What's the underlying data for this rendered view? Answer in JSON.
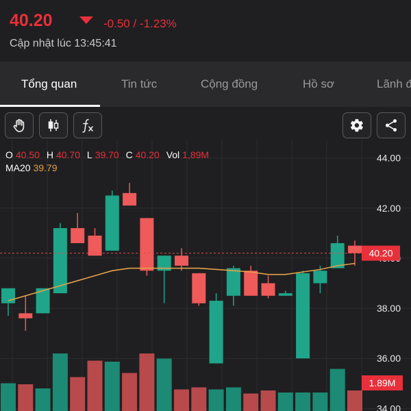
{
  "quote": {
    "price": "40.20",
    "change": "-0.50 / -1.23%",
    "updated": "Cập nhật lúc 13:45:41",
    "direction_icon": "triangle-down-icon"
  },
  "tabs": [
    {
      "label": "Tổng quan",
      "active": true
    },
    {
      "label": "Tin tức",
      "active": false
    },
    {
      "label": "Cộng đồng",
      "active": false
    },
    {
      "label": "Hồ sơ",
      "active": false
    },
    {
      "label": "Lãnh đ",
      "active": false
    }
  ],
  "toolbar": {
    "left": [
      "hand-icon",
      "candlestick-icon",
      "function-icon"
    ],
    "right": [
      "gear-icon",
      "share-icon"
    ]
  },
  "legend": {
    "o_label": "O",
    "o": "40.50",
    "h_label": "H",
    "h": "40.70",
    "l_label": "L",
    "l": "39.70",
    "c_label": "C",
    "c": "40.20",
    "vol_label": "Vol",
    "vol": "1,89M",
    "ma_label": "MA20",
    "ma": "39.79"
  },
  "colors": {
    "up": "#1fa58a",
    "down": "#ef5a5a",
    "price_tag": "#e8303a",
    "ma": "#e4a14a",
    "background": "#1f1f21"
  },
  "chart_data": {
    "type": "candlestick",
    "y_ticks": [
      "44.00",
      "42.00",
      "40.00",
      "38.00",
      "36.00",
      "34.00"
    ],
    "y_range": [
      33.9,
      44.7
    ],
    "last_price_label": "40.20",
    "last_volume_label": "1.89M",
    "grid": true,
    "candles": [
      {
        "o": 38.2,
        "h": 38.6,
        "l": 37.7,
        "c": 38.8,
        "vol": 1.35,
        "up": true
      },
      {
        "o": 37.8,
        "h": 38.5,
        "l": 37.1,
        "c": 37.6,
        "vol": 1.3,
        "up": false
      },
      {
        "o": 37.8,
        "h": 38.7,
        "l": 37.8,
        "c": 38.8,
        "vol": 1.1,
        "up": true
      },
      {
        "o": 38.6,
        "h": 41.4,
        "l": 38.6,
        "c": 41.2,
        "vol": 2.8,
        "up": true
      },
      {
        "o": 41.2,
        "h": 41.8,
        "l": 40.9,
        "c": 40.6,
        "vol": 1.65,
        "up": false
      },
      {
        "o": 40.9,
        "h": 41.2,
        "l": 40.6,
        "c": 40.1,
        "vol": 2.45,
        "up": false
      },
      {
        "o": 40.3,
        "h": 42.7,
        "l": 40.3,
        "c": 42.5,
        "vol": 2.4,
        "up": true
      },
      {
        "o": 42.6,
        "h": 43.0,
        "l": 42.1,
        "c": 42.1,
        "vol": 1.85,
        "up": false
      },
      {
        "o": 41.6,
        "h": 41.6,
        "l": 39.3,
        "c": 39.5,
        "vol": 2.8,
        "up": false
      },
      {
        "o": 39.5,
        "h": 40.1,
        "l": 38.2,
        "c": 40.1,
        "vol": 2.55,
        "up": true
      },
      {
        "o": 40.1,
        "h": 40.4,
        "l": 39.5,
        "c": 39.7,
        "vol": 1.05,
        "up": false
      },
      {
        "o": 39.4,
        "h": 39.4,
        "l": 38.1,
        "c": 38.2,
        "vol": 1.15,
        "up": false
      },
      {
        "o": 38.3,
        "h": 38.6,
        "l": 35.9,
        "c": 35.8,
        "vol": 1.05,
        "up": true
      },
      {
        "o": 39.6,
        "h": 39.7,
        "l": 38.1,
        "c": 38.5,
        "vol": 1.15,
        "up": true
      },
      {
        "o": 39.5,
        "h": 39.7,
        "l": 38.6,
        "c": 38.5,
        "vol": 0.85,
        "up": false
      },
      {
        "o": 39.0,
        "h": 39.3,
        "l": 38.4,
        "c": 38.5,
        "vol": 1.0,
        "up": false
      },
      {
        "o": 38.6,
        "h": 38.7,
        "l": 38.5,
        "c": 38.5,
        "vol": 0.9,
        "up": true
      },
      {
        "o": 39.4,
        "h": 39.5,
        "l": 36.0,
        "c": 36.0,
        "vol": 0.9,
        "up": true
      },
      {
        "o": 39.0,
        "h": 39.7,
        "l": 38.6,
        "c": 39.5,
        "vol": 0.9,
        "up": true
      },
      {
        "o": 39.6,
        "h": 40.9,
        "l": 39.6,
        "c": 40.6,
        "vol": 2.05,
        "up": true
      },
      {
        "o": 40.5,
        "h": 40.7,
        "l": 39.7,
        "c": 40.2,
        "vol": 1.0,
        "up": false
      }
    ],
    "ma20": [
      38.3,
      38.5,
      38.7,
      38.9,
      39.1,
      39.3,
      39.5,
      39.6,
      39.6,
      39.6,
      39.6,
      39.6,
      39.55,
      39.5,
      39.45,
      39.35,
      39.35,
      39.45,
      39.55,
      39.7,
      39.79
    ]
  }
}
